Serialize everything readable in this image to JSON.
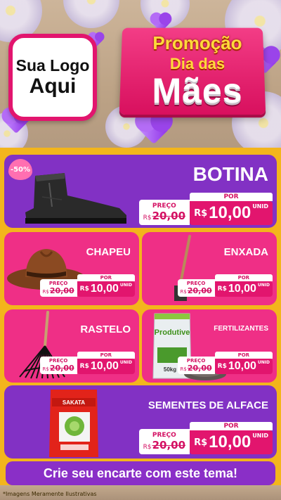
{
  "header": {
    "logo_line1": "Sua Logo",
    "logo_line2": "Aqui",
    "promo_line1": "Promoção",
    "promo_line2": "Dia das",
    "promo_line3": "Mães"
  },
  "colors": {
    "purple": "#8231c4",
    "pink": "#ef2f86",
    "gold": "#f3b51c",
    "price_red": "#e2156e"
  },
  "products": [
    {
      "name": "BOTINA",
      "discount_badge": "-50%",
      "old_label": "PREÇO",
      "old_currency": "R$",
      "old_price": "20,00",
      "new_label": "POR",
      "new_currency": "R$",
      "new_price": "10,00",
      "unit": "UNID",
      "icon": "boot-icon"
    },
    {
      "name": "CHAPEU",
      "old_label": "PREÇO",
      "old_currency": "R$",
      "old_price": "20,00",
      "new_label": "POR",
      "new_currency": "R$",
      "new_price": "10,00",
      "unit": "UNID",
      "icon": "hat-icon"
    },
    {
      "name": "ENXADA",
      "old_label": "PREÇO",
      "old_currency": "R$",
      "old_price": "20,00",
      "new_label": "POR",
      "new_currency": "R$",
      "new_price": "10,00",
      "unit": "UNID",
      "icon": "hoe-icon"
    },
    {
      "name": "RASTELO",
      "old_label": "PREÇO",
      "old_currency": "R$",
      "old_price": "20,00",
      "new_label": "POR",
      "new_currency": "R$",
      "new_price": "10,00",
      "unit": "UNID",
      "icon": "rake-icon"
    },
    {
      "name": "FERTILIZANTES",
      "old_label": "PREÇO",
      "old_currency": "R$",
      "old_price": "20,00",
      "new_label": "POR",
      "new_currency": "R$",
      "new_price": "10,00",
      "unit": "UNID",
      "icon": "fertilizer-bag-icon",
      "bag_brand": "Produtive",
      "bag_weight": "50kg"
    },
    {
      "name": "SEMENTES DE ALFACE",
      "old_label": "PREÇO",
      "old_currency": "R$",
      "old_price": "20,00",
      "new_label": "POR",
      "new_currency": "R$",
      "new_price": "10,00",
      "unit": "UNID",
      "icon": "seed-packet-icon",
      "packet_brand": "SAKATA"
    }
  ],
  "cta": "Crie seu encarte com este tema!",
  "footnote": "*Imagens Meramente Ilustrativas"
}
